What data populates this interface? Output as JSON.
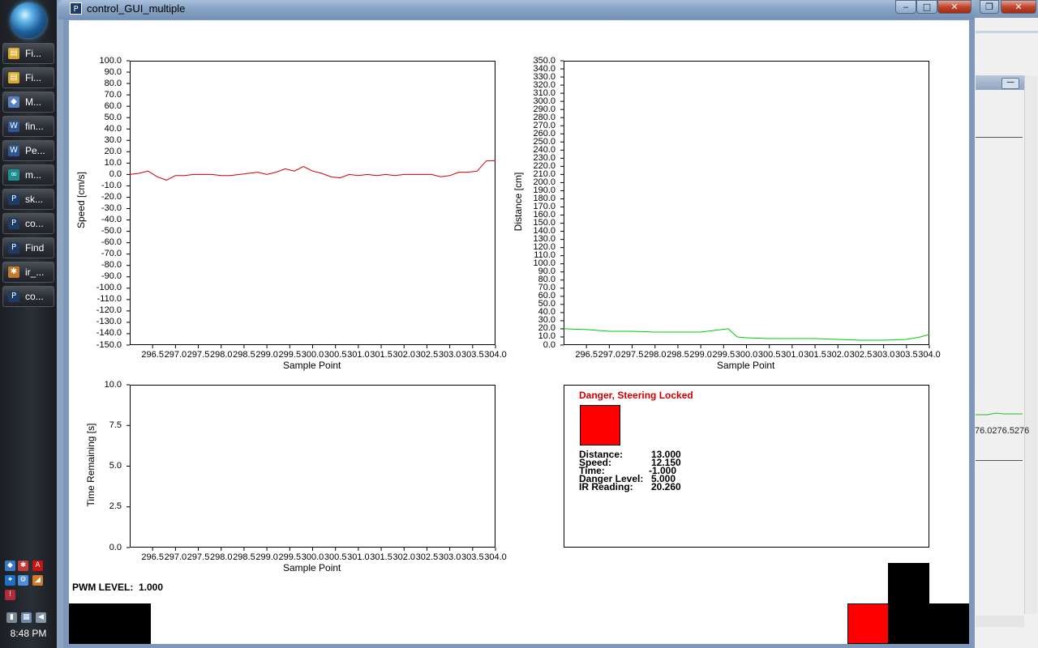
{
  "window": {
    "title": "control_GUI_multiple",
    "app_icon_glyph": "P",
    "controls": {
      "minimize": "‒",
      "maximize": "□",
      "close": "✕",
      "restore": "❐"
    }
  },
  "taskbar": {
    "items": [
      {
        "label": "Fi...",
        "icon": "folder-icon",
        "color": "#d9a92c",
        "glyph": "▤"
      },
      {
        "label": "Fi...",
        "icon": "folder-icon",
        "color": "#d9a92c",
        "glyph": "▤"
      },
      {
        "label": "M...",
        "icon": "app-icon",
        "color": "#5a7fc2",
        "glyph": "◆"
      },
      {
        "label": "fin...",
        "icon": "word-icon",
        "color": "#2b5797",
        "glyph": "W"
      },
      {
        "label": "Pe...",
        "icon": "word-icon",
        "color": "#2b5797",
        "glyph": "W"
      },
      {
        "label": "m...",
        "icon": "arduino-icon",
        "color": "#1b8e8e",
        "glyph": "∞"
      },
      {
        "label": "sk...",
        "icon": "processing-icon",
        "color": "#1e3d66",
        "glyph": "P"
      },
      {
        "label": "co...",
        "icon": "processing-icon",
        "color": "#1e3d66",
        "glyph": "P"
      },
      {
        "label": "Find",
        "icon": "processing-icon",
        "color": "#1e3d66",
        "glyph": "P"
      },
      {
        "label": "ir_...",
        "icon": "paint-icon",
        "color": "#c27a2a",
        "glyph": "✱"
      },
      {
        "label": "co...",
        "icon": "processing-icon",
        "color": "#1e3d66",
        "glyph": "P"
      }
    ],
    "clock": "8:48 PM"
  },
  "background_window": {
    "ticks": "76.0276.5276"
  },
  "charts": {
    "speed": {
      "ylabel": "Speed [cm/s]",
      "xlabel": "Sample Point",
      "line_color": "#cc0000"
    },
    "distance": {
      "ylabel": "Distance [cm]",
      "xlabel": "Sample Point",
      "line_color": "#00cc00"
    },
    "time": {
      "ylabel": "Time Remaining [s]",
      "xlabel": "Sample Point"
    }
  },
  "chart_data": [
    {
      "type": "line",
      "ylabel": "Speed [cm/s]",
      "xlabel": "Sample Point",
      "ylim": [
        -150,
        100
      ],
      "xlim": [
        296.0,
        304.0
      ],
      "yticks": [
        "100.0",
        "90.0",
        "80.0",
        "70.0",
        "60.0",
        "50.0",
        "40.0",
        "30.0",
        "20.0",
        "10.0",
        "0.0",
        "-10.0",
        "-20.0",
        "-30.0",
        "-40.0",
        "-50.0",
        "-60.0",
        "-70.0",
        "-80.0",
        "-90.0",
        "-100.0",
        "-110.0",
        "-120.0",
        "-130.0",
        "-140.0",
        "-150.0"
      ],
      "xticks": [
        "296.5",
        "297.0",
        "297.5",
        "298.0",
        "298.5",
        "299.0",
        "299.5",
        "300.0",
        "300.5",
        "301.0",
        "301.5",
        "302.0",
        "302.5",
        "303.0",
        "303.5",
        "304.0"
      ],
      "x": [
        296.0,
        296.2,
        296.4,
        296.6,
        296.8,
        297.0,
        297.2,
        297.4,
        297.6,
        297.8,
        298.0,
        298.2,
        298.4,
        298.6,
        298.8,
        299.0,
        299.2,
        299.4,
        299.6,
        299.8,
        300.0,
        300.2,
        300.4,
        300.6,
        300.8,
        301.0,
        301.2,
        301.4,
        301.6,
        301.8,
        302.0,
        302.2,
        302.4,
        302.6,
        302.8,
        303.0,
        303.2,
        303.4,
        303.6,
        303.8,
        304.0
      ],
      "y": [
        0.0,
        1.0,
        3.0,
        -2.0,
        -5.0,
        -1.0,
        -1.0,
        0.0,
        0.0,
        0.0,
        -1.0,
        -1.0,
        0.0,
        1.0,
        2.0,
        0.0,
        2.0,
        5.0,
        3.0,
        7.0,
        3.0,
        1.0,
        -2.0,
        -3.0,
        0.0,
        -1.0,
        0.0,
        -1.0,
        0.0,
        -1.0,
        0.0,
        0.0,
        0.0,
        0.0,
        -2.0,
        -1.0,
        2.0,
        2.0,
        3.0,
        12.0,
        12.15
      ]
    },
    {
      "type": "line",
      "ylabel": "Distance [cm]",
      "xlabel": "Sample Point",
      "ylim": [
        0,
        350
      ],
      "xlim": [
        296.0,
        304.0
      ],
      "yticks": [
        "350.0",
        "340.0",
        "330.0",
        "320.0",
        "310.0",
        "300.0",
        "290.0",
        "280.0",
        "270.0",
        "260.0",
        "250.0",
        "240.0",
        "230.0",
        "220.0",
        "210.0",
        "200.0",
        "190.0",
        "180.0",
        "170.0",
        "160.0",
        "150.0",
        "140.0",
        "130.0",
        "120.0",
        "110.0",
        "100.0",
        "90.0",
        "80.0",
        "70.0",
        "60.0",
        "50.0",
        "40.0",
        "30.0",
        "20.0",
        "10.0",
        "0.0"
      ],
      "xticks": [
        "296.5",
        "297.0",
        "297.5",
        "298.0",
        "298.5",
        "299.0",
        "299.5",
        "300.0",
        "300.5",
        "301.0",
        "301.5",
        "302.0",
        "302.5",
        "303.0",
        "303.5",
        "304.0"
      ],
      "x": [
        296.0,
        296.5,
        297.0,
        297.5,
        298.0,
        298.5,
        299.0,
        299.3,
        299.6,
        299.8,
        300.0,
        300.5,
        301.0,
        301.5,
        302.0,
        302.5,
        303.0,
        303.5,
        303.8,
        304.0
      ],
      "y": [
        20.0,
        19.0,
        17.0,
        17.0,
        16.0,
        16.0,
        16.0,
        18.0,
        20.0,
        10.0,
        9.0,
        8.0,
        8.0,
        8.0,
        7.0,
        6.0,
        6.0,
        7.0,
        10.0,
        13.0
      ]
    },
    {
      "type": "line",
      "ylabel": "Time Remaining [s]",
      "xlabel": "Sample Point",
      "ylim": [
        0,
        10
      ],
      "xlim": [
        296.0,
        304.0
      ],
      "yticks": [
        "10.0",
        "7.5",
        "5.0",
        "2.5",
        "0.0"
      ],
      "xticks": [
        "296.5",
        "297.0",
        "297.5",
        "298.0",
        "298.5",
        "299.0",
        "299.5",
        "300.0",
        "300.5",
        "301.0",
        "301.5",
        "302.0",
        "302.5",
        "303.0",
        "303.5",
        "304.0"
      ],
      "x": [],
      "y": []
    }
  ],
  "status": {
    "title": "Danger, Steering Locked",
    "title_color": "#cc0000",
    "indicator_color": "#ff0000",
    "rows": [
      {
        "label": "Distance:",
        "value": "13.000"
      },
      {
        "label": "Speed:",
        "value": "12.150"
      },
      {
        "label": "Time:",
        "value": "-1.000"
      },
      {
        "label": "Danger Level:",
        "value": "5.000"
      },
      {
        "label": "IR Reading:",
        "value": "20.260"
      }
    ]
  },
  "pwm": {
    "label": "PWM LEVEL:",
    "value": "1.000"
  }
}
